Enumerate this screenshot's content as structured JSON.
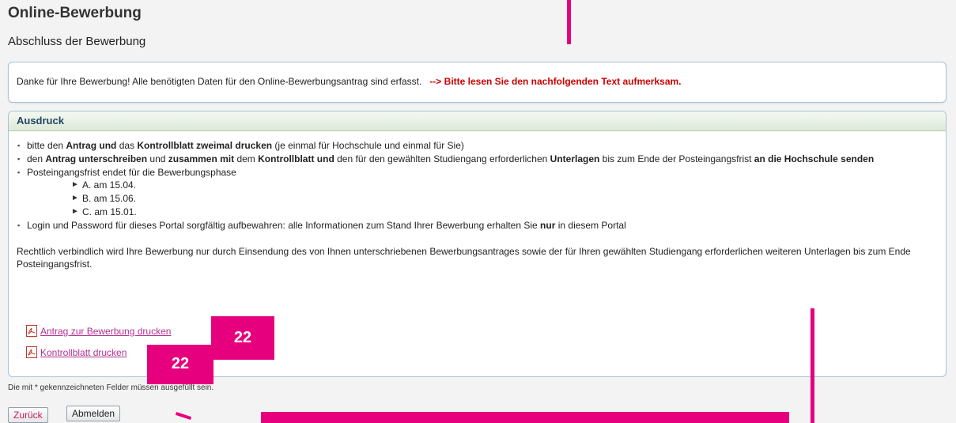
{
  "header": {
    "title": "Online-Bewerbung",
    "subtitle": "Abschluss der Bewerbung"
  },
  "notice": {
    "text": "Danke für Ihre Bewerbung! Alle benötigten Daten für den Online-Bewerbungsantrag sind erfasst.",
    "highlight": "--> Bitte lesen Sie den nachfolgenden Text aufmerksam."
  },
  "panel": {
    "title": "Ausdruck",
    "b1": {
      "t1": "bitte den ",
      "t2": "Antrag und",
      "t3": " das ",
      "t4": "Kontrollblatt zweimal drucken",
      "t5": " (je einmal für Hochschule und einmal für Sie)"
    },
    "b2": {
      "t1": "den ",
      "t2": "Antrag unterschreiben",
      "t3": " und ",
      "t4": "zusammen mit",
      "t5": " dem ",
      "t6": "Kontrollblatt und",
      "t7": " den für den gewählten Studiengang erforderlichen ",
      "t8": "Unterlagen",
      "t9": " bis zum Ende der Posteingangsfrist ",
      "t10": "an die Hochschule senden"
    },
    "b3": {
      "text": "Posteingangsfrist endet für die Bewerbungsphase",
      "sub": [
        "A. am 15.04.",
        "B. am 15.06.",
        "C. am 15.01."
      ]
    },
    "b4": {
      "t1": "Login und Password für dieses Portal sorgfältig aufbewahren: alle Informationen zum Stand Ihrer Bewerbung erhalten Sie ",
      "t2": "nur",
      "t3": " in diesem Portal"
    },
    "paragraph": "Rechtlich verbindlich wird Ihre Bewerbung nur durch Einsendung des von Ihnen unterschriebenen Bewerbungsantrages sowie der für Ihren gewählten Studiengang erforderlichen weiteren Unterlagen bis zum Ende Posteingangsfrist.",
    "link_application": "Antrag zur Bewerbung drucken",
    "link_checklist": "Kontrollblatt drucken"
  },
  "footer": {
    "required_note": "Die mit * gekennzeichneten Felder müssen ausgefüllt sein.",
    "back_label": "Zurück",
    "logout_label": "Abmelden"
  },
  "annotations": {
    "badge1": "22",
    "badge2": "22"
  },
  "colors": {
    "marker": "#e6007e",
    "highlight": "#cc0000",
    "link": "#b03090"
  }
}
